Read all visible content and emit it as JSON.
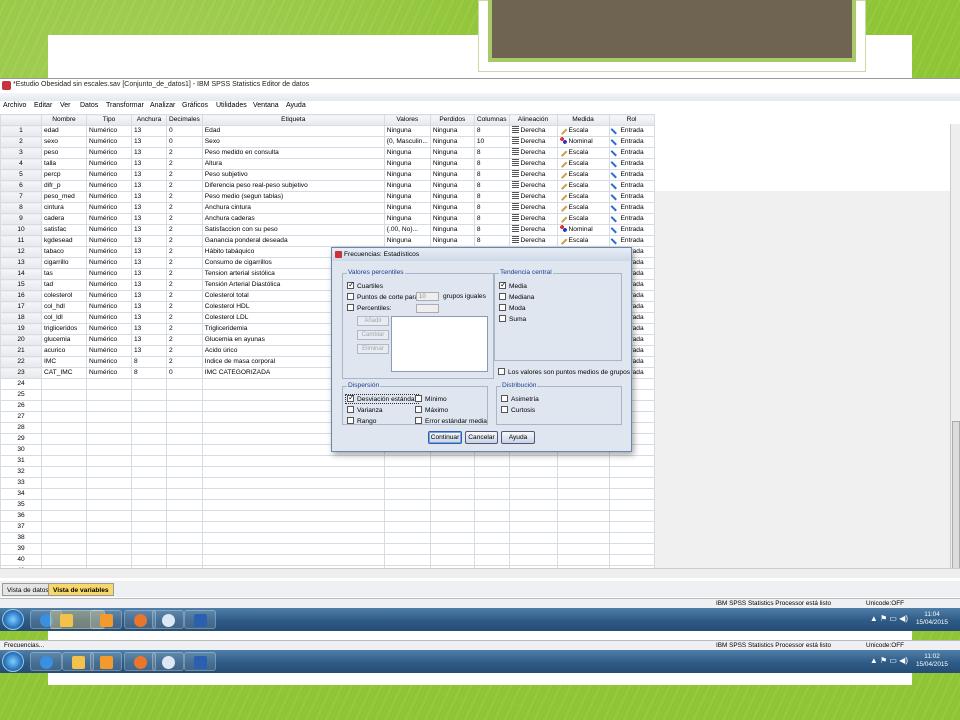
{
  "window": {
    "title": "*Estudio Obesidad sin escales.sav [Conjunto_de_datos1] - IBM SPSS Statistics Editor de datos"
  },
  "menu": [
    "Archivo",
    "Editar",
    "Ver",
    "Datos",
    "Transformar",
    "Analizar",
    "Gráficos",
    "Utilidades",
    "Ventana",
    "Ayuda"
  ],
  "columns": [
    "Nombre",
    "Tipo",
    "Anchura",
    "Decimales",
    "Etiqueta",
    "Valores",
    "Perdidos",
    "Columnas",
    "Alineación",
    "Medida",
    "Rol"
  ],
  "rows": [
    {
      "n": "1",
      "nombre": "edad",
      "tipo": "Numérico",
      "anchura": "13",
      "dec": "0",
      "etiqueta": "Edad",
      "valores": "Ninguna",
      "perdidos": "Ninguna",
      "columnas": "8",
      "alin": "Derecha",
      "medida": "Escala",
      "rol": "Entrada"
    },
    {
      "n": "2",
      "nombre": "sexo",
      "tipo": "Numérico",
      "anchura": "13",
      "dec": "0",
      "etiqueta": "Sexo",
      "valores": "{0, Masculin...",
      "perdidos": "Ninguna",
      "columnas": "10",
      "alin": "Derecha",
      "medida": "Nominal",
      "rol": "Entrada"
    },
    {
      "n": "3",
      "nombre": "peso",
      "tipo": "Numérico",
      "anchura": "13",
      "dec": "2",
      "etiqueta": "Peso medido en consulta",
      "valores": "Ninguna",
      "perdidos": "Ninguna",
      "columnas": "8",
      "alin": "Derecha",
      "medida": "Escala",
      "rol": "Entrada"
    },
    {
      "n": "4",
      "nombre": "talla",
      "tipo": "Numérico",
      "anchura": "13",
      "dec": "2",
      "etiqueta": "Altura",
      "valores": "Ninguna",
      "perdidos": "Ninguna",
      "columnas": "8",
      "alin": "Derecha",
      "medida": "Escala",
      "rol": "Entrada"
    },
    {
      "n": "5",
      "nombre": "percp",
      "tipo": "Numérico",
      "anchura": "13",
      "dec": "2",
      "etiqueta": "Peso subjetivo",
      "valores": "Ninguna",
      "perdidos": "Ninguna",
      "columnas": "8",
      "alin": "Derecha",
      "medida": "Escala",
      "rol": "Entrada"
    },
    {
      "n": "6",
      "nombre": "difr_p",
      "tipo": "Numérico",
      "anchura": "13",
      "dec": "2",
      "etiqueta": "Diferencia peso real-peso subjetivo",
      "valores": "Ninguna",
      "perdidos": "Ninguna",
      "columnas": "8",
      "alin": "Derecha",
      "medida": "Escala",
      "rol": "Entrada"
    },
    {
      "n": "7",
      "nombre": "peso_med",
      "tipo": "Numérico",
      "anchura": "13",
      "dec": "2",
      "etiqueta": "Peso medio (segun tablas)",
      "valores": "Ninguna",
      "perdidos": "Ninguna",
      "columnas": "8",
      "alin": "Derecha",
      "medida": "Escala",
      "rol": "Entrada"
    },
    {
      "n": "8",
      "nombre": "cintura",
      "tipo": "Numérico",
      "anchura": "13",
      "dec": "2",
      "etiqueta": "Anchura cintura",
      "valores": "Ninguna",
      "perdidos": "Ninguna",
      "columnas": "8",
      "alin": "Derecha",
      "medida": "Escala",
      "rol": "Entrada"
    },
    {
      "n": "9",
      "nombre": "cadera",
      "tipo": "Numérico",
      "anchura": "13",
      "dec": "2",
      "etiqueta": "Anchura caderas",
      "valores": "Ninguna",
      "perdidos": "Ninguna",
      "columnas": "8",
      "alin": "Derecha",
      "medida": "Escala",
      "rol": "Entrada"
    },
    {
      "n": "10",
      "nombre": "satisfac",
      "tipo": "Numérico",
      "anchura": "13",
      "dec": "2",
      "etiqueta": "Satisfaccion con su peso",
      "valores": "{.00, No}...",
      "perdidos": "Ninguna",
      "columnas": "8",
      "alin": "Derecha",
      "medida": "Nominal",
      "rol": "Entrada"
    },
    {
      "n": "11",
      "nombre": "kgdesead",
      "tipo": "Numérico",
      "anchura": "13",
      "dec": "2",
      "etiqueta": "Ganancia ponderal deseada",
      "valores": "Ninguna",
      "perdidos": "Ninguna",
      "columnas": "8",
      "alin": "Derecha",
      "medida": "Escala",
      "rol": "Entrada"
    },
    {
      "n": "12",
      "nombre": "tabaco",
      "tipo": "Numérico",
      "anchura": "13",
      "dec": "2",
      "etiqueta": "Hábito tabáquico",
      "valores": "",
      "perdidos": "",
      "columnas": "",
      "alin": "",
      "medida": "",
      "rol": "Entrada"
    },
    {
      "n": "13",
      "nombre": "cigarrillo",
      "tipo": "Numérico",
      "anchura": "13",
      "dec": "2",
      "etiqueta": "Consumo de cigarrillos",
      "valores": "",
      "perdidos": "",
      "columnas": "",
      "alin": "",
      "medida": "",
      "rol": "Entrada"
    },
    {
      "n": "14",
      "nombre": "tas",
      "tipo": "Numérico",
      "anchura": "13",
      "dec": "2",
      "etiqueta": "Tension arterial sistólica",
      "valores": "",
      "perdidos": "",
      "columnas": "",
      "alin": "",
      "medida": "",
      "rol": "Entrada"
    },
    {
      "n": "15",
      "nombre": "tad",
      "tipo": "Numérico",
      "anchura": "13",
      "dec": "2",
      "etiqueta": "Tensión Arterial Diastólica",
      "valores": "",
      "perdidos": "",
      "columnas": "",
      "alin": "",
      "medida": "",
      "rol": "Entrada"
    },
    {
      "n": "16",
      "nombre": "colesterol",
      "tipo": "Numérico",
      "anchura": "13",
      "dec": "2",
      "etiqueta": "Colesterol total",
      "valores": "",
      "perdidos": "",
      "columnas": "",
      "alin": "",
      "medida": "",
      "rol": "Entrada"
    },
    {
      "n": "17",
      "nombre": "col_hdl",
      "tipo": "Numérico",
      "anchura": "13",
      "dec": "2",
      "etiqueta": "Colesterol HDL",
      "valores": "",
      "perdidos": "",
      "columnas": "",
      "alin": "",
      "medida": "",
      "rol": "Entrada"
    },
    {
      "n": "18",
      "nombre": "col_ldl",
      "tipo": "Numérico",
      "anchura": "13",
      "dec": "2",
      "etiqueta": "Colesterol LDL",
      "valores": "",
      "perdidos": "",
      "columnas": "",
      "alin": "",
      "medida": "",
      "rol": "Entrada"
    },
    {
      "n": "19",
      "nombre": "trigliceridos",
      "tipo": "Numérico",
      "anchura": "13",
      "dec": "2",
      "etiqueta": "Trigliceridemia",
      "valores": "",
      "perdidos": "",
      "columnas": "",
      "alin": "",
      "medida": "",
      "rol": "Entrada"
    },
    {
      "n": "20",
      "nombre": "glucemia",
      "tipo": "Numérico",
      "anchura": "13",
      "dec": "2",
      "etiqueta": "Glucemia en ayunas",
      "valores": "",
      "perdidos": "",
      "columnas": "",
      "alin": "",
      "medida": "",
      "rol": "Entrada"
    },
    {
      "n": "21",
      "nombre": "acurico",
      "tipo": "Numérico",
      "anchura": "13",
      "dec": "2",
      "etiqueta": "Acido úrico",
      "valores": "",
      "perdidos": "",
      "columnas": "",
      "alin": "",
      "medida": "",
      "rol": "Entrada"
    },
    {
      "n": "22",
      "nombre": "IMC",
      "tipo": "Numérico",
      "anchura": "8",
      "dec": "2",
      "etiqueta": "Indice de masa corporal",
      "valores": "",
      "perdidos": "",
      "columnas": "",
      "alin": "",
      "medida": "",
      "rol": "Entrada"
    },
    {
      "n": "23",
      "nombre": "CAT_IMC",
      "tipo": "Numérico",
      "anchura": "8",
      "dec": "0",
      "etiqueta": "IMC CATEGORIZADA",
      "valores": "",
      "perdidos": "",
      "columnas": "",
      "alin": "",
      "medida": "",
      "rol": "Entrada"
    }
  ],
  "empty_rows": [
    "24",
    "25",
    "26",
    "27",
    "28",
    "29",
    "30",
    "31",
    "32",
    "33",
    "34",
    "35",
    "36",
    "37",
    "38",
    "39",
    "40",
    "41"
  ],
  "tabs": {
    "data_view": "Vista de datos",
    "variable_view": "Vista de variables"
  },
  "status": {
    "processor": "IBM SPSS Statistics Processor está listo",
    "unicode": "Unicode:OFF"
  },
  "status2": {
    "left": "Frecuencias...",
    "processor": "IBM SPSS Statistics Processor está listo",
    "unicode": "Unicode:OFF"
  },
  "clock1": {
    "time": "11:04",
    "date": "15/04/2015"
  },
  "clock2": {
    "time": "11:02",
    "date": "15/04/2015"
  },
  "dialog": {
    "title": "Frecuencias: Estadísticos",
    "percentiles_title": "Valores percentiles",
    "cuartiles": "Cuartiles",
    "puntos_corte": "Puntos de corte para:",
    "puntos_value": "10",
    "grupos_iguales": "grupos iguales",
    "percentiles": "Percentiles:",
    "anadir": "Añadir",
    "cambiar": "Cambiar",
    "eliminar": "Eliminar",
    "tendencia_title": "Tendencia central",
    "media": "Media",
    "mediana": "Mediana",
    "moda": "Moda",
    "suma": "Suma",
    "puntos_medios": "Los valores son puntos medios de grupos",
    "dispersion_title": "Dispersión",
    "desviacion": "Desviación estándar",
    "minimo": "Mínimo",
    "varianza": "Varianza",
    "maximo": "Máximo",
    "rango": "Rango",
    "error": "Error estándar media",
    "distribucion_title": "Distribución",
    "asimetria": "Asimetría",
    "curtosis": "Curtosis",
    "continuar": "Continuar",
    "cancelar": "Cancelar",
    "ayuda": "Ayuda"
  }
}
